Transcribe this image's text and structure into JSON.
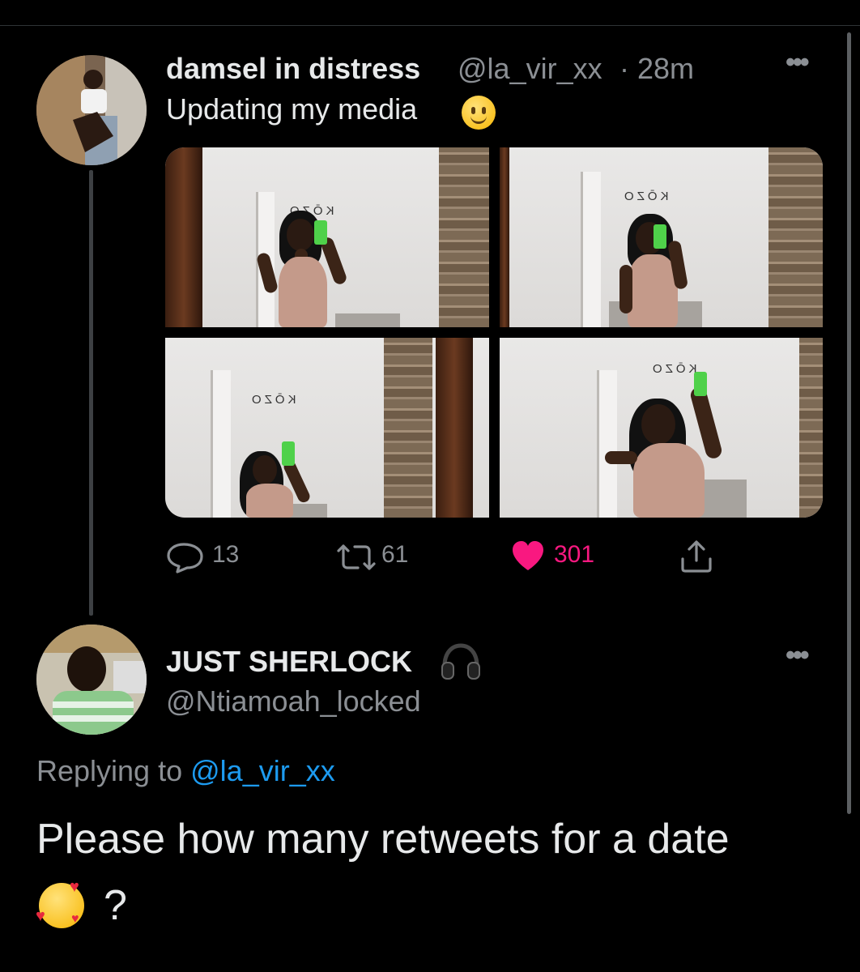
{
  "main_tweet": {
    "display_name": "damsel in distress",
    "handle": "@la_vir_xx",
    "separator": "·",
    "time": "28m",
    "text": "Updating my media",
    "emoji": "slightly-smiling-face",
    "photo_sign_text": "KŌZO",
    "replies": "13",
    "retweets": "61",
    "likes": "301"
  },
  "reply_tweet": {
    "display_name": "JUST SHERLOCK",
    "name_emoji": "headphones",
    "handle": "@Ntiamoah_locked",
    "replying_prefix": "Replying to",
    "replying_to": "@la_vir_xx",
    "text": "Please how many retweets for a date",
    "trailing_emoji": "smiling-face-with-hearts",
    "trailing_text": "?"
  },
  "colors": {
    "background": "#000000",
    "primary_text": "#e7e9ea",
    "secondary_text": "#8b8f94",
    "link": "#1d9bf0",
    "like": "#f91880"
  }
}
